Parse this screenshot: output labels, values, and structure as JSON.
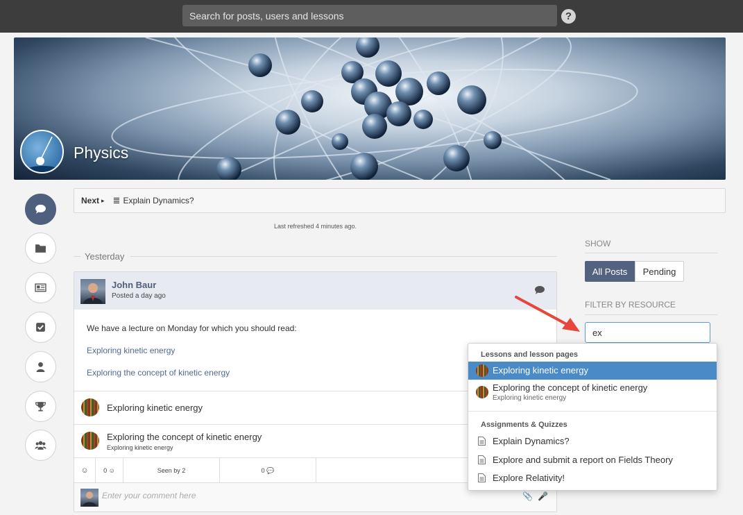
{
  "topbar": {
    "search_placeholder": "Search for posts, users and lessons",
    "help_glyph": "?"
  },
  "course": {
    "title": "Physics"
  },
  "sidebar": {
    "items": [
      {
        "icon": "comment-icon",
        "active": true
      },
      {
        "icon": "folder-icon",
        "active": false
      },
      {
        "icon": "newspaper-icon",
        "active": false
      },
      {
        "icon": "checkbox-icon",
        "active": false
      },
      {
        "icon": "user-icon",
        "active": false
      },
      {
        "icon": "trophy-icon",
        "active": false
      },
      {
        "icon": "group-icon",
        "active": false
      }
    ]
  },
  "next_bar": {
    "next_label": "Next",
    "next_caret": "▸",
    "list_glyph": "≣",
    "item_title": "Explain Dynamics?"
  },
  "feed": {
    "refreshed": "Last refreshed 4 minutes ago.",
    "day_label": "Yesterday"
  },
  "post": {
    "author": "John Baur",
    "posted": "Posted a day ago",
    "text": "We have a lecture on Monday for which you should read:",
    "links": [
      "Exploring kinetic energy",
      "Exploring the concept of kinetic energy"
    ],
    "resources": [
      {
        "title": "Exploring kinetic energy",
        "subtitle": ""
      },
      {
        "title": "Exploring the concept of kinetic energy",
        "subtitle": "Exploring kinetic energy"
      }
    ],
    "stats": {
      "smile": "☺",
      "reactions": "0 ☺",
      "seen": "Seen by 2",
      "comments": "0 💬"
    },
    "comment_placeholder": "Enter your comment here",
    "attach_glyph": "📎",
    "mic_glyph": "🎤"
  },
  "right_panel": {
    "show_label": "SHOW",
    "buttons": {
      "all": "All Posts",
      "pending": "Pending"
    },
    "filter_label": "FILTER BY RESOURCE",
    "filter_value": "ex"
  },
  "dropdown": {
    "section1": "Lessons and lesson pages",
    "lessons": [
      {
        "title": "Exploring kinetic energy",
        "subtitle": "",
        "active": true
      },
      {
        "title": "Exploring the concept of kinetic energy",
        "subtitle": "Exploring kinetic energy",
        "active": false
      }
    ],
    "section2": "Assignments & Quizzes",
    "assignments": [
      "Explain Dynamics?",
      "Explore and submit a report on Fields Theory",
      "Explore Relativity!"
    ]
  },
  "colors": {
    "topbar": "#3d3d3d",
    "accent": "#53627f",
    "highlight": "#4a8ac6",
    "arrow": "#e8453c"
  }
}
